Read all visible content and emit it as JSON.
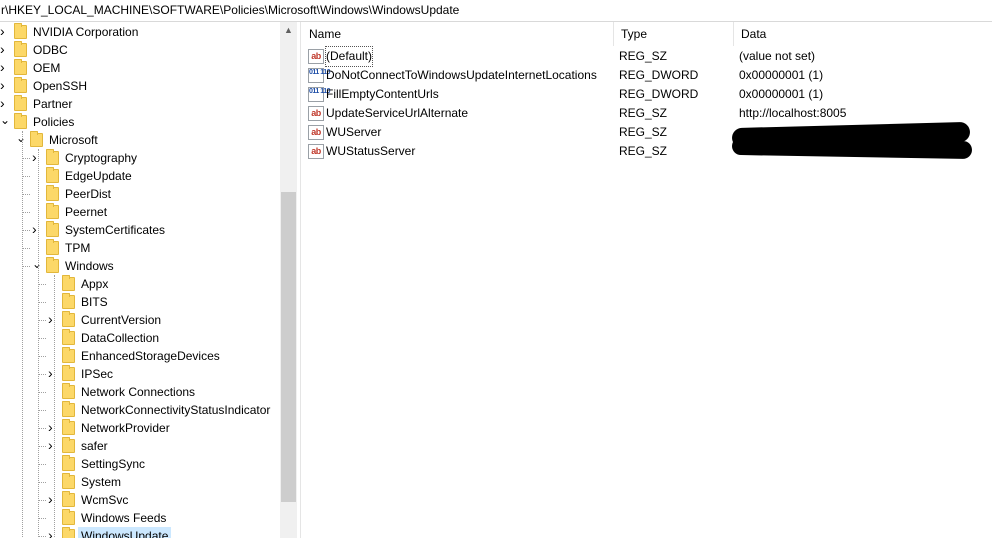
{
  "address": {
    "path": "r\\HKEY_LOCAL_MACHINE\\SOFTWARE\\Policies\\Microsoft\\Windows\\WindowsUpdate"
  },
  "tree": {
    "items": [
      {
        "label": "NVIDIA Corporation",
        "level": 0,
        "expander": "collapsed"
      },
      {
        "label": "ODBC",
        "level": 0,
        "expander": "collapsed"
      },
      {
        "label": "OEM",
        "level": 0,
        "expander": "collapsed"
      },
      {
        "label": "OpenSSH",
        "level": 0,
        "expander": "collapsed"
      },
      {
        "label": "Partner",
        "level": 0,
        "expander": "collapsed"
      },
      {
        "label": "Policies",
        "level": 0,
        "expander": "expanded"
      },
      {
        "label": "Microsoft",
        "level": 1,
        "expander": "expanded"
      },
      {
        "label": "Cryptography",
        "level": 2,
        "expander": "collapsed"
      },
      {
        "label": "EdgeUpdate",
        "level": 2,
        "expander": "none"
      },
      {
        "label": "PeerDist",
        "level": 2,
        "expander": "none"
      },
      {
        "label": "Peernet",
        "level": 2,
        "expander": "none"
      },
      {
        "label": "SystemCertificates",
        "level": 2,
        "expander": "collapsed"
      },
      {
        "label": "TPM",
        "level": 2,
        "expander": "none"
      },
      {
        "label": "Windows",
        "level": 2,
        "expander": "expanded"
      },
      {
        "label": "Appx",
        "level": 3,
        "expander": "none"
      },
      {
        "label": "BITS",
        "level": 3,
        "expander": "none"
      },
      {
        "label": "CurrentVersion",
        "level": 3,
        "expander": "collapsed"
      },
      {
        "label": "DataCollection",
        "level": 3,
        "expander": "none"
      },
      {
        "label": "EnhancedStorageDevices",
        "level": 3,
        "expander": "none"
      },
      {
        "label": "IPSec",
        "level": 3,
        "expander": "collapsed"
      },
      {
        "label": "Network Connections",
        "level": 3,
        "expander": "none"
      },
      {
        "label": "NetworkConnectivityStatusIndicator",
        "level": 3,
        "expander": "none"
      },
      {
        "label": "NetworkProvider",
        "level": 3,
        "expander": "collapsed"
      },
      {
        "label": "safer",
        "level": 3,
        "expander": "collapsed"
      },
      {
        "label": "SettingSync",
        "level": 3,
        "expander": "none"
      },
      {
        "label": "System",
        "level": 3,
        "expander": "none"
      },
      {
        "label": "WcmSvc",
        "level": 3,
        "expander": "collapsed"
      },
      {
        "label": "Windows Feeds",
        "level": 3,
        "expander": "none"
      },
      {
        "label": "WindowsUpdate",
        "level": 3,
        "expander": "collapsed",
        "selected": true
      }
    ]
  },
  "values": {
    "columns": {
      "name": "Name",
      "type": "Type",
      "data": "Data"
    },
    "rows": [
      {
        "name": "(Default)",
        "type": "REG_SZ",
        "data": "(value not set)",
        "icon": "string-value-icon",
        "icon_text": "ab"
      },
      {
        "name": "DoNotConnectToWindowsUpdateInternetLocations",
        "type": "REG_DWORD",
        "data": "0x00000001 (1)",
        "icon": "binary-value-icon",
        "icon_text": "011 110"
      },
      {
        "name": "FillEmptyContentUrls",
        "type": "REG_DWORD",
        "data": "0x00000001 (1)",
        "icon": "binary-value-icon",
        "icon_text": "011 110"
      },
      {
        "name": "UpdateServiceUrlAlternate",
        "type": "REG_SZ",
        "data": "http://localhost:8005",
        "icon": "string-value-icon",
        "icon_text": "ab"
      },
      {
        "name": "WUServer",
        "type": "REG_SZ",
        "data": "",
        "icon": "string-value-icon",
        "icon_text": "ab",
        "redacted": true
      },
      {
        "name": "WUStatusServer",
        "type": "REG_SZ",
        "data": "",
        "icon": "string-value-icon",
        "icon_text": "ab",
        "redacted": true
      }
    ]
  },
  "colors": {
    "folder": "#fcd868",
    "selection": "#cce8ff",
    "string_icon": "#c0392b",
    "binary_icon": "#1f4fa8"
  }
}
